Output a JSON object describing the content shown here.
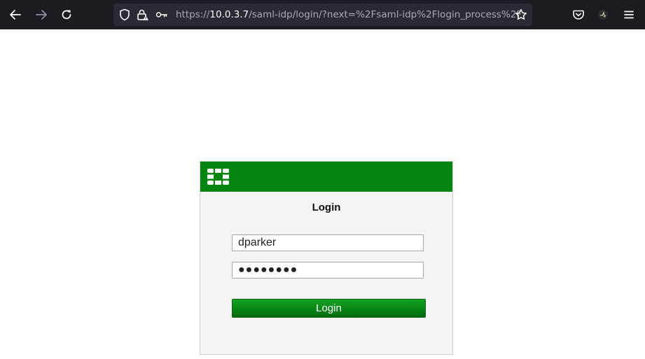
{
  "browser": {
    "url_prefix": "https://",
    "url_host": "10.0.3.7",
    "url_rest": "/saml-idp/login/?next=%2Fsaml-idp%2Flogin_process%2F",
    "icons": [
      "back-icon",
      "forward-icon",
      "reload-icon",
      "shield-icon",
      "insecure-lock-icon",
      "key-icon",
      "bookmark-star-icon",
      "pocket-icon",
      "extension-icon",
      "menu-icon"
    ]
  },
  "login": {
    "title": "Login",
    "username": "dparker",
    "password_mask": "●●●●●●●●",
    "button_label": "Login"
  },
  "colors": {
    "header_green": "#03850f",
    "button_green": "#0a8a17",
    "toolbar_bg": "#1c1b22"
  }
}
